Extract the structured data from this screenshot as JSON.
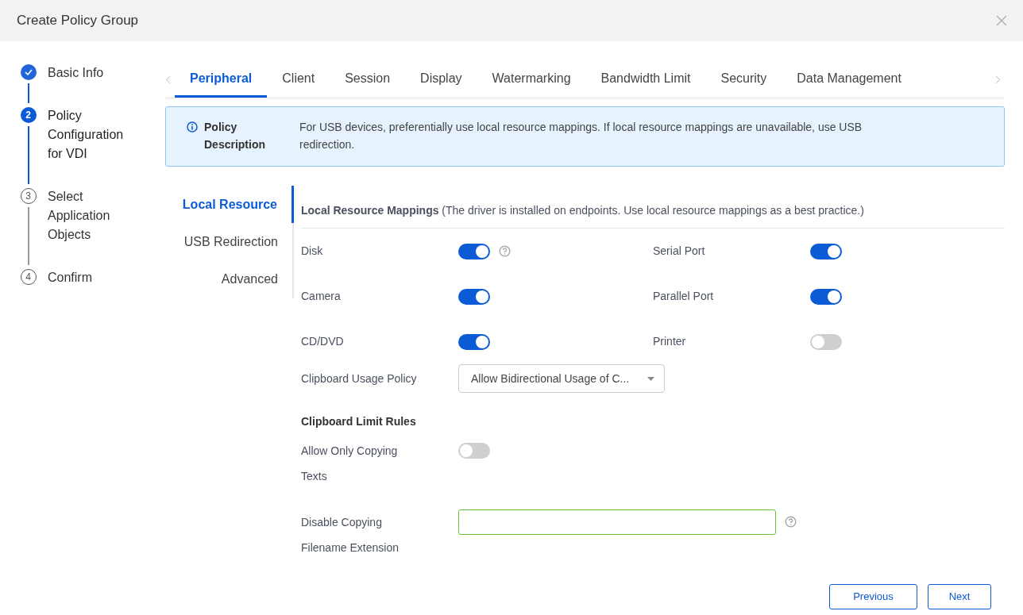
{
  "dialog": {
    "title": "Create Policy Group"
  },
  "steps": [
    {
      "label": "Basic Info",
      "done": true,
      "selected": false
    },
    {
      "marker": "2",
      "label": "Policy Configuration for VDI",
      "done": false,
      "selected": true
    },
    {
      "marker": "3",
      "label": "Select Application Objects",
      "done": false,
      "selected": false
    },
    {
      "marker": "4",
      "label": "Confirm",
      "done": false,
      "selected": false
    }
  ],
  "tabs": [
    {
      "label": "Peripheral",
      "selected": true
    },
    {
      "label": "Client",
      "selected": false
    },
    {
      "label": "Session",
      "selected": false
    },
    {
      "label": "Display",
      "selected": false
    },
    {
      "label": "Watermarking",
      "selected": false
    },
    {
      "label": "Bandwidth Limit",
      "selected": false
    },
    {
      "label": "Security",
      "selected": false
    },
    {
      "label": "Data Management",
      "selected": false
    }
  ],
  "policy_description": {
    "title": "Policy Description",
    "text": "For USB devices, preferentially use local resource mappings. If local resource mappings are unavailable, use USB redirection."
  },
  "side_nav": [
    {
      "label": "Local Resource",
      "selected": true
    },
    {
      "label": "USB Redirection",
      "selected": false
    },
    {
      "label": "Advanced",
      "selected": false
    }
  ],
  "section": {
    "title": "Local Resource Mappings",
    "note": "(The driver is installed on endpoints. Use local resource mappings as a best practice.)"
  },
  "mappings": [
    {
      "label": "Disk",
      "on": true,
      "help": true
    },
    {
      "label": "Serial Port",
      "on": true,
      "help": false
    },
    {
      "label": "Camera",
      "on": true,
      "help": false
    },
    {
      "label": "Parallel Port",
      "on": true,
      "help": false
    },
    {
      "label": "CD/DVD",
      "on": true,
      "help": false
    },
    {
      "label": "Printer",
      "on": false,
      "help": false
    }
  ],
  "clipboard_policy": {
    "label": "Clipboard Usage Policy",
    "value": "Allow Bidirectional Usage of C..."
  },
  "limit_rules": {
    "title": "Clipboard Limit Rules",
    "copy_texts_only": {
      "label": "Allow Only Copying Texts",
      "on": false
    },
    "disable_extension": {
      "label": "Disable Copying Filename Extension"
    }
  },
  "buttons": [
    {
      "label": "Previous"
    },
    {
      "label": "Next"
    }
  ]
}
